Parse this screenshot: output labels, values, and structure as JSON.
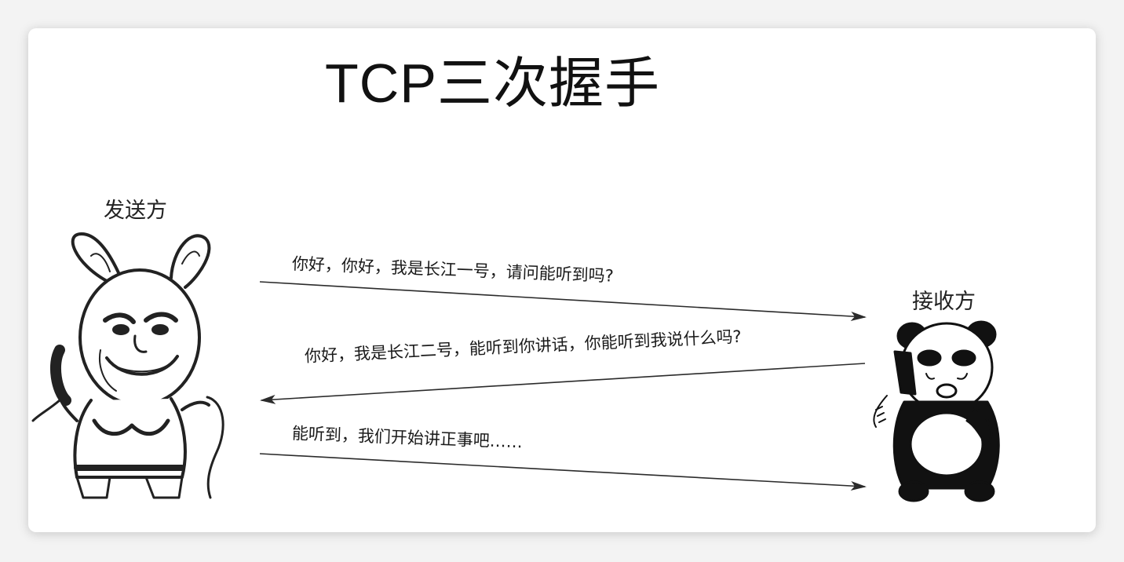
{
  "title": "TCP三次握手",
  "sender": {
    "label": "发送方"
  },
  "receiver": {
    "label": "接收方"
  },
  "messages": [
    {
      "text": "你好，你好，我是长江一号，请问能听到吗?",
      "direction": "sender-to-receiver"
    },
    {
      "text": "你好，我是长江二号，能听到你讲话，你能听到我说什么吗?",
      "direction": "receiver-to-sender"
    },
    {
      "text": "能听到，我们开始讲正事吧……",
      "direction": "sender-to-receiver"
    }
  ],
  "colors": {
    "background": "#ffffff",
    "ink": "#111111",
    "arrow": "#333333"
  }
}
